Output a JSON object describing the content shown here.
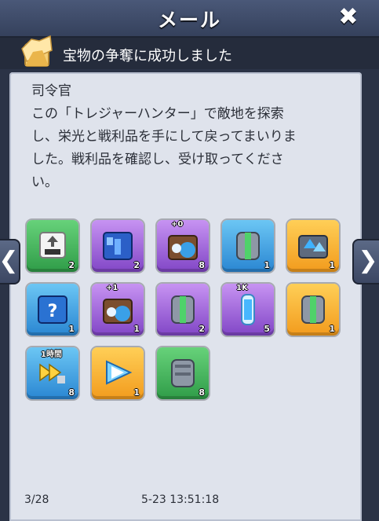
{
  "header": {
    "title": "メール",
    "close_label": "✖"
  },
  "mail": {
    "subject": "宝物の争奪に成功しました",
    "sender": "司令官",
    "body": [
      "この「トレジャーハンター」で敵地を探索",
      "し、栄光と戦利品を手にして戻ってまいりま",
      "した。戦利品を確認し、受け取ってくださ",
      "い。"
    ]
  },
  "items": [
    {
      "name": "exp-card",
      "color": "green",
      "tag": "",
      "qty": "2"
    },
    {
      "name": "blue-crate",
      "color": "purple",
      "tag": "",
      "qty": "2"
    },
    {
      "name": "upgrade-mask-crate",
      "color": "purple",
      "tag": "+0",
      "qty": "8"
    },
    {
      "name": "armor-part",
      "color": "blue",
      "tag": "",
      "qty": "1"
    },
    {
      "name": "crystal-chest",
      "color": "orange",
      "tag": "",
      "qty": "1"
    },
    {
      "name": "mystery-crate",
      "color": "blue",
      "tag": "",
      "qty": "1"
    },
    {
      "name": "upgrade-mask-crate",
      "color": "purple",
      "tag": "+1",
      "qty": "1"
    },
    {
      "name": "armor-part",
      "color": "purple",
      "tag": "",
      "qty": "2"
    },
    {
      "name": "energy-canister",
      "color": "purple",
      "tag": "1K",
      "qty": "5"
    },
    {
      "name": "armor-part",
      "color": "orange",
      "tag": "",
      "qty": "1"
    },
    {
      "name": "speedup-1h",
      "color": "blue",
      "tag": "1時間",
      "qty": "8"
    },
    {
      "name": "speed-triangle",
      "color": "orange",
      "tag": "",
      "qty": "1"
    },
    {
      "name": "armor-part-gray",
      "color": "green",
      "tag": "",
      "qty": "8"
    }
  ],
  "footer": {
    "page": "3/28",
    "timestamp": "5-23 13:51:18"
  },
  "nav": {
    "prev": "❮",
    "next": "❯"
  }
}
